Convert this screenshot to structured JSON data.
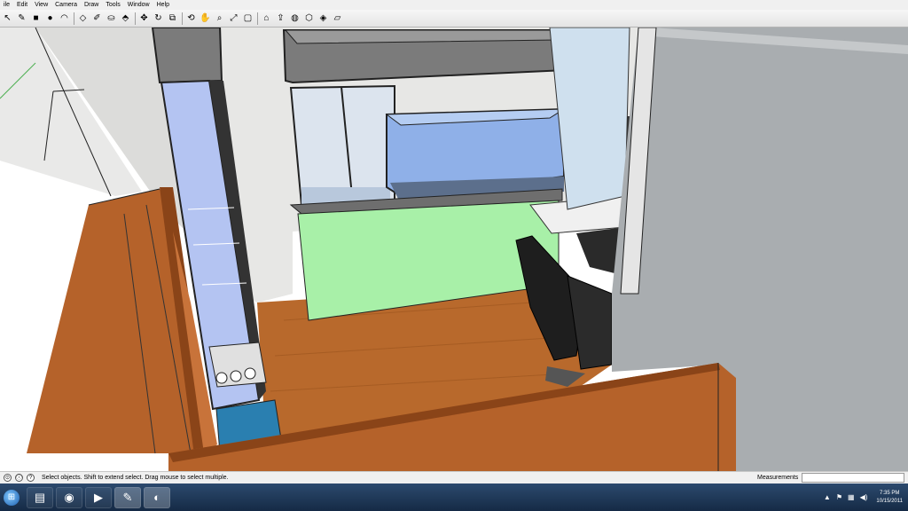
{
  "menubar": {
    "items": [
      "ile",
      "Edit",
      "View",
      "Camera",
      "Draw",
      "Tools",
      "Window",
      "Help"
    ]
  },
  "toolbar": {
    "tools": [
      {
        "name": "select-tool-icon",
        "glyph": "↖"
      },
      {
        "name": "pencil-tool-icon",
        "glyph": "✎"
      },
      {
        "name": "rectangle-tool-icon",
        "glyph": "■"
      },
      {
        "name": "circle-tool-icon",
        "glyph": "●"
      },
      {
        "name": "arc-tool-icon",
        "glyph": "◠"
      },
      {
        "name": "eraser-tool-icon",
        "glyph": "◇"
      },
      {
        "name": "tape-measure-tool-icon",
        "glyph": "✐"
      },
      {
        "name": "paint-bucket-tool-icon",
        "glyph": "⛀"
      },
      {
        "name": "push-pull-tool-icon",
        "glyph": "⬘"
      },
      {
        "name": "move-tool-icon",
        "glyph": "✥"
      },
      {
        "name": "rotate-tool-icon",
        "glyph": "↻"
      },
      {
        "name": "offset-tool-icon",
        "glyph": "⧉"
      },
      {
        "name": "orbit-tool-icon",
        "glyph": "⟲"
      },
      {
        "name": "pan-tool-icon",
        "glyph": "✋"
      },
      {
        "name": "zoom-tool-icon",
        "glyph": "⌕"
      },
      {
        "name": "zoom-extents-tool-icon",
        "glyph": "⤢"
      },
      {
        "name": "previous-view-icon",
        "glyph": "▢"
      },
      {
        "name": "get-models-icon",
        "glyph": "⌂"
      },
      {
        "name": "share-model-icon",
        "glyph": "⇪"
      },
      {
        "name": "google-earth-icon",
        "glyph": "◍"
      },
      {
        "name": "components-icon",
        "glyph": "⬡"
      },
      {
        "name": "materials-icon",
        "glyph": "◈"
      },
      {
        "name": "styles-icon",
        "glyph": "▱"
      }
    ]
  },
  "statusbar": {
    "icons": [
      "geo-location-icon",
      "credits-icon",
      "help-icon"
    ],
    "message": "Select objects. Shift to extend select. Drag mouse to select multiple.",
    "measurements_label": "Measurements"
  },
  "taskbar": {
    "apps": [
      {
        "name": "windows-explorer-icon",
        "glyph": "▤",
        "active": false
      },
      {
        "name": "chrome-icon",
        "glyph": "◉",
        "active": false
      },
      {
        "name": "media-player-icon",
        "glyph": "▶",
        "active": false
      },
      {
        "name": "sketchup-icon",
        "glyph": "✎",
        "active": true
      },
      {
        "name": "paint-icon",
        "glyph": "◐",
        "active": true
      }
    ],
    "time": "7:35 PM",
    "date": "10/15/2011"
  },
  "colors": {
    "wood": "#b5622a",
    "wood_dark": "#8a4418",
    "floor": "#b8692c",
    "glass_blue": "#8fb0e8",
    "stand_green": "#a8f0a8",
    "wall": "#e7e7e5",
    "wall_shadow": "#a9adb0",
    "black": "#1a1a1a"
  }
}
